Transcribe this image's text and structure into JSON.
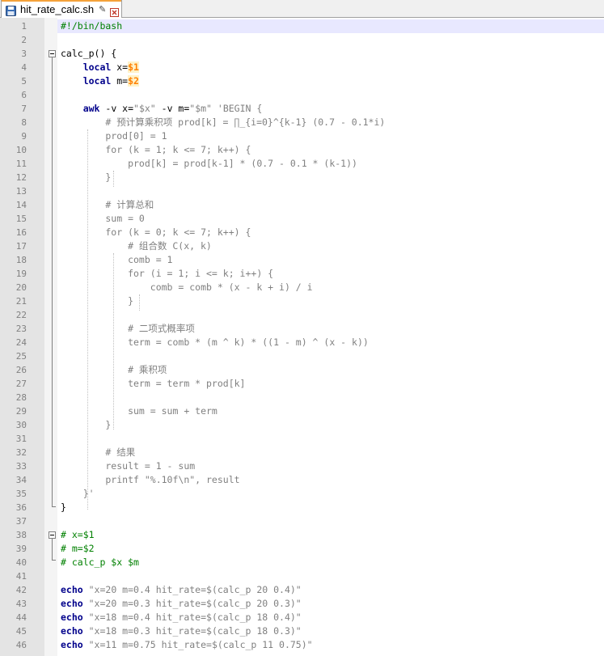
{
  "tab": {
    "filename": "hit_rate_calc.sh",
    "icons": [
      "save-icon",
      "pin-icon",
      "close-icon"
    ]
  },
  "colors": {
    "keyword": "#00008b",
    "variable": "#ff8000",
    "comment": "#008000",
    "string": "#808080",
    "tab_accent": "#f5a23a",
    "current_line": "#e8e8ff"
  },
  "editor": {
    "lines": [
      {
        "n": "1",
        "tokens": [
          {
            "t": "#!/bin/bash",
            "c": "com"
          }
        ]
      },
      {
        "n": "2",
        "tokens": []
      },
      {
        "n": "3",
        "tokens": [
          {
            "t": "calc_p() {",
            "c": "def"
          }
        ]
      },
      {
        "n": "4",
        "tokens": [
          {
            "t": "    ",
            "c": "def"
          },
          {
            "t": "local",
            "c": "kw"
          },
          {
            "t": " x=",
            "c": "def"
          },
          {
            "t": "$1",
            "c": "var"
          }
        ]
      },
      {
        "n": "5",
        "tokens": [
          {
            "t": "    ",
            "c": "def"
          },
          {
            "t": "local",
            "c": "kw"
          },
          {
            "t": " m=",
            "c": "def"
          },
          {
            "t": "$2",
            "c": "var"
          }
        ]
      },
      {
        "n": "6",
        "tokens": []
      },
      {
        "n": "7",
        "tokens": [
          {
            "t": "    ",
            "c": "def"
          },
          {
            "t": "awk",
            "c": "kw"
          },
          {
            "t": " -v x=",
            "c": "def"
          },
          {
            "t": "\"$x\"",
            "c": "str"
          },
          {
            "t": " -v m=",
            "c": "def"
          },
          {
            "t": "\"$m\"",
            "c": "str"
          },
          {
            "t": " 'BEGIN {",
            "c": "str"
          }
        ]
      },
      {
        "n": "8",
        "tokens": [
          {
            "t": "        # 预计算乘积项 prod[k] = ∏_{i=0}^{k-1} (0.7 - 0.1*i)",
            "c": "str"
          }
        ]
      },
      {
        "n": "9",
        "tokens": [
          {
            "t": "        prod[0] = 1",
            "c": "str"
          }
        ]
      },
      {
        "n": "10",
        "tokens": [
          {
            "t": "        for (k = 1; k <= 7; k++) {",
            "c": "str"
          }
        ]
      },
      {
        "n": "11",
        "tokens": [
          {
            "t": "            prod[k] = prod[k-1] * (0.7 - 0.1 * (k-1))",
            "c": "str"
          }
        ]
      },
      {
        "n": "12",
        "tokens": [
          {
            "t": "        }",
            "c": "str"
          }
        ]
      },
      {
        "n": "13",
        "tokens": []
      },
      {
        "n": "14",
        "tokens": [
          {
            "t": "        # 计算总和",
            "c": "str"
          }
        ]
      },
      {
        "n": "15",
        "tokens": [
          {
            "t": "        sum = 0",
            "c": "str"
          }
        ]
      },
      {
        "n": "16",
        "tokens": [
          {
            "t": "        for (k = 0; k <= 7; k++) {",
            "c": "str"
          }
        ]
      },
      {
        "n": "17",
        "tokens": [
          {
            "t": "            # 组合数 C(x, k)",
            "c": "str"
          }
        ]
      },
      {
        "n": "18",
        "tokens": [
          {
            "t": "            comb = 1",
            "c": "str"
          }
        ]
      },
      {
        "n": "19",
        "tokens": [
          {
            "t": "            for (i = 1; i <= k; i++) {",
            "c": "str"
          }
        ]
      },
      {
        "n": "20",
        "tokens": [
          {
            "t": "                comb = comb * (x - k + i) / i",
            "c": "str"
          }
        ]
      },
      {
        "n": "21",
        "tokens": [
          {
            "t": "            }",
            "c": "str"
          }
        ]
      },
      {
        "n": "22",
        "tokens": []
      },
      {
        "n": "23",
        "tokens": [
          {
            "t": "            # 二项式概率项",
            "c": "str"
          }
        ]
      },
      {
        "n": "24",
        "tokens": [
          {
            "t": "            term = comb * (m ^ k) * ((1 - m) ^ (x - k))",
            "c": "str"
          }
        ]
      },
      {
        "n": "25",
        "tokens": []
      },
      {
        "n": "26",
        "tokens": [
          {
            "t": "            # 乘积项",
            "c": "str"
          }
        ]
      },
      {
        "n": "27",
        "tokens": [
          {
            "t": "            term = term * prod[k]",
            "c": "str"
          }
        ]
      },
      {
        "n": "28",
        "tokens": []
      },
      {
        "n": "29",
        "tokens": [
          {
            "t": "            sum = sum + term",
            "c": "str"
          }
        ]
      },
      {
        "n": "30",
        "tokens": [
          {
            "t": "        }",
            "c": "str"
          }
        ]
      },
      {
        "n": "31",
        "tokens": []
      },
      {
        "n": "32",
        "tokens": [
          {
            "t": "        # 结果",
            "c": "str"
          }
        ]
      },
      {
        "n": "33",
        "tokens": [
          {
            "t": "        result = 1 - sum",
            "c": "str"
          }
        ]
      },
      {
        "n": "34",
        "tokens": [
          {
            "t": "        printf \"%.10f\\n\", result",
            "c": "str"
          }
        ]
      },
      {
        "n": "35",
        "tokens": [
          {
            "t": "    }'",
            "c": "str"
          }
        ]
      },
      {
        "n": "36",
        "tokens": [
          {
            "t": "}",
            "c": "def"
          }
        ]
      },
      {
        "n": "37",
        "tokens": []
      },
      {
        "n": "38",
        "tokens": [
          {
            "t": "# x=$1",
            "c": "com"
          }
        ]
      },
      {
        "n": "39",
        "tokens": [
          {
            "t": "# m=$2",
            "c": "com"
          }
        ]
      },
      {
        "n": "40",
        "tokens": [
          {
            "t": "# calc_p $x $m",
            "c": "com"
          }
        ]
      },
      {
        "n": "41",
        "tokens": []
      },
      {
        "n": "42",
        "tokens": [
          {
            "t": "echo",
            "c": "kw"
          },
          {
            "t": " \"x=20 m=0.4 hit_rate=$(calc_p 20 0.4)\"",
            "c": "str"
          }
        ]
      },
      {
        "n": "43",
        "tokens": [
          {
            "t": "echo",
            "c": "kw"
          },
          {
            "t": " \"x=20 m=0.3 hit_rate=$(calc_p 20 0.3)\"",
            "c": "str"
          }
        ]
      },
      {
        "n": "44",
        "tokens": [
          {
            "t": "echo",
            "c": "kw"
          },
          {
            "t": " \"x=18 m=0.4 hit_rate=$(calc_p 18 0.4)\"",
            "c": "str"
          }
        ]
      },
      {
        "n": "45",
        "tokens": [
          {
            "t": "echo",
            "c": "kw"
          },
          {
            "t": " \"x=18 m=0.3 hit_rate=$(calc_p 18 0.3)\"",
            "c": "str"
          }
        ]
      },
      {
        "n": "46",
        "tokens": [
          {
            "t": "echo",
            "c": "kw"
          },
          {
            "t": " \"x=11 m=0.75 hit_rate=$(calc_p 11 0.75)\"",
            "c": "str"
          }
        ]
      }
    ]
  }
}
